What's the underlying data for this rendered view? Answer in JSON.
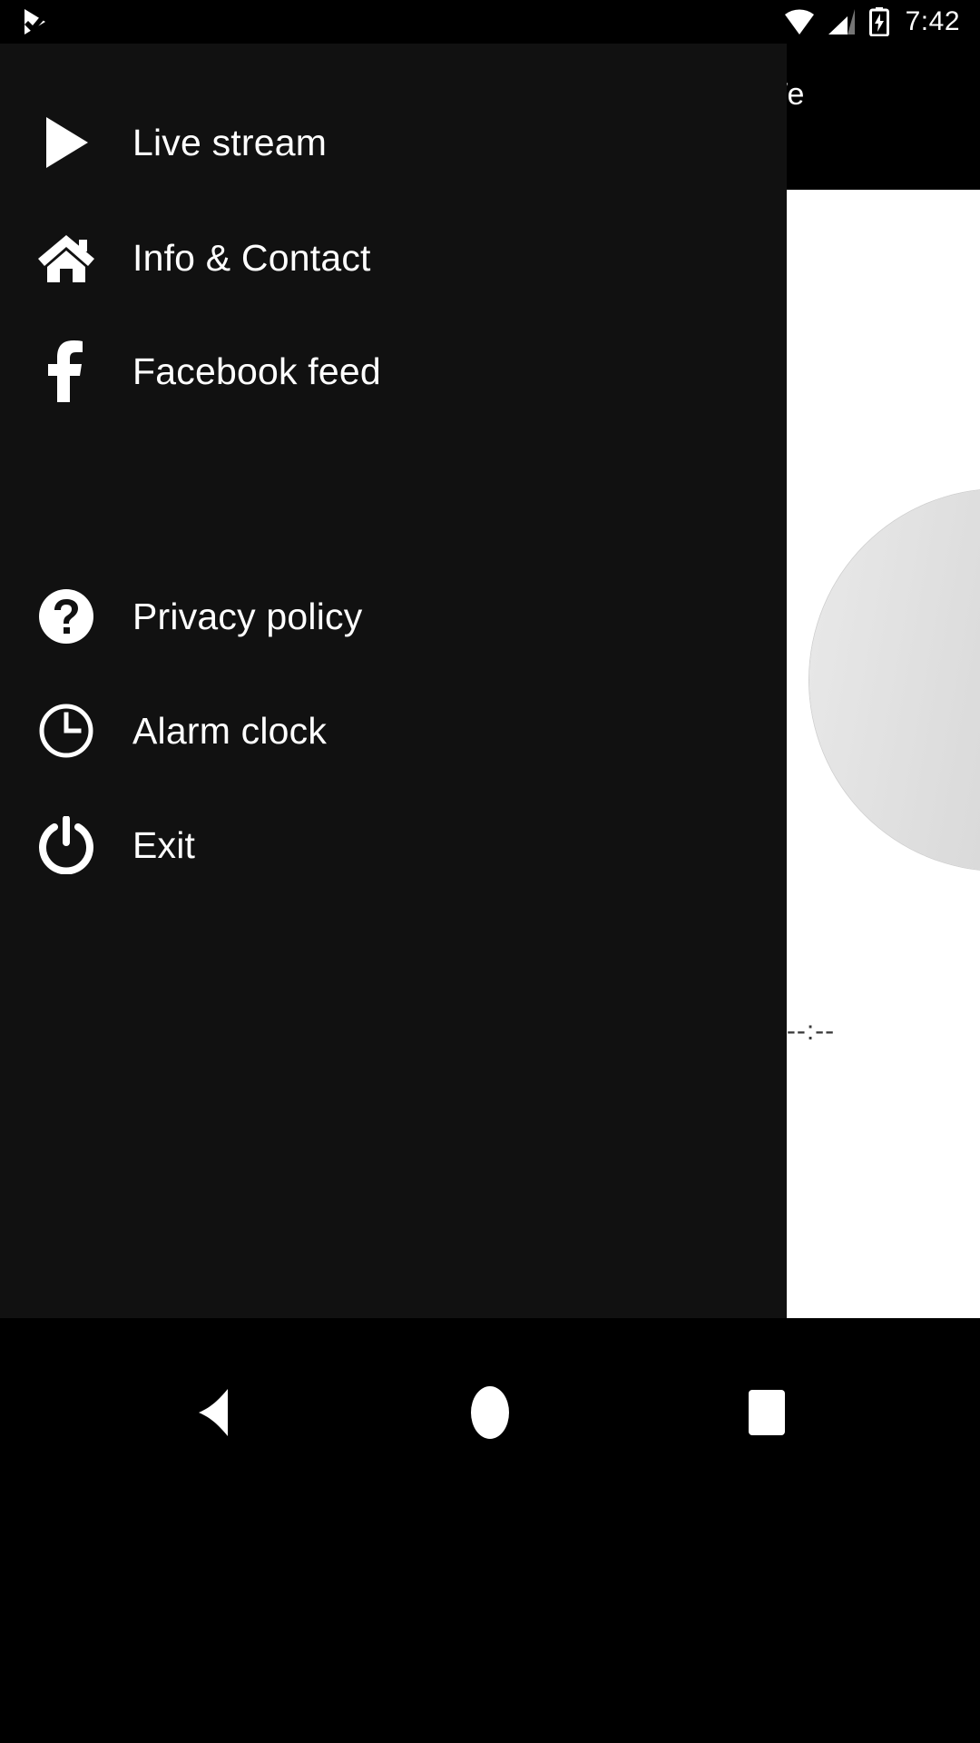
{
  "status_bar": {
    "notification_icon": "play-check-icon",
    "wifi_icon": "wifi-icon",
    "signal_icon": "cellular-signal-icon",
    "battery_icon": "battery-charging-icon",
    "clock": "7:42"
  },
  "ad_banner": {
    "close_icon": "close-x-icon",
    "label": "We",
    "close_bg": "#ff0000",
    "close_border": "#e8881a",
    "close_x_color": "#f7b4b4"
  },
  "drawer": {
    "background": "#111111",
    "primary_items": [
      {
        "label": "Live stream",
        "icon": "play-icon"
      },
      {
        "label": "Info & Contact",
        "icon": "home-icon"
      },
      {
        "label": "Facebook feed",
        "icon": "facebook-icon"
      }
    ],
    "secondary_items": [
      {
        "label": "Privacy policy",
        "icon": "help-circle-icon"
      },
      {
        "label": "Alarm clock",
        "icon": "clock-icon"
      },
      {
        "label": "Exit",
        "icon": "power-icon"
      }
    ]
  },
  "content": {
    "time_display": "--:--",
    "disc_icon": "circular-disc-graphic",
    "background": "#ffffff"
  },
  "system_nav": {
    "back": "back-triangle-icon",
    "home": "home-circle-icon",
    "recents": "recents-square-icon"
  }
}
